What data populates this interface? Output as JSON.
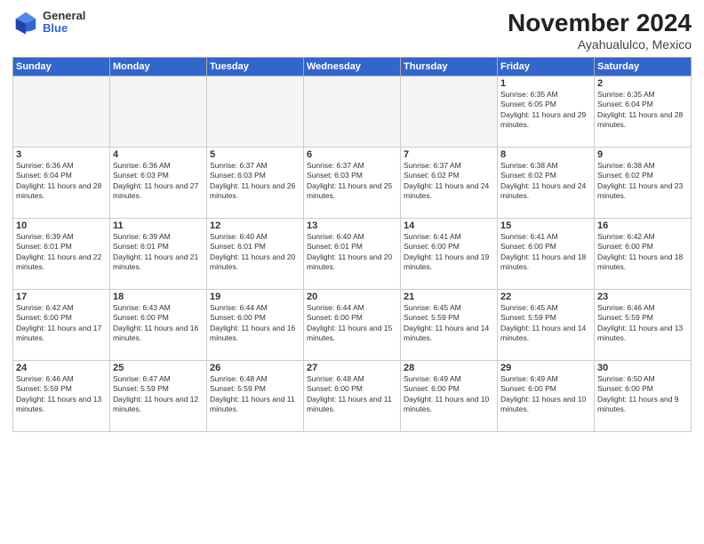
{
  "header": {
    "logo": {
      "general": "General",
      "blue": "Blue"
    },
    "title": "November 2024",
    "subtitle": "Ayahualulco, Mexico"
  },
  "weekdays": [
    "Sunday",
    "Monday",
    "Tuesday",
    "Wednesday",
    "Thursday",
    "Friday",
    "Saturday"
  ],
  "weeks": [
    [
      {
        "day": "",
        "info": "",
        "empty": true
      },
      {
        "day": "",
        "info": "",
        "empty": true
      },
      {
        "day": "",
        "info": "",
        "empty": true
      },
      {
        "day": "",
        "info": "",
        "empty": true
      },
      {
        "day": "",
        "info": "",
        "empty": true
      },
      {
        "day": "1",
        "info": "Sunrise: 6:35 AM\nSunset: 6:05 PM\nDaylight: 11 hours and 29 minutes.",
        "empty": false
      },
      {
        "day": "2",
        "info": "Sunrise: 6:35 AM\nSunset: 6:04 PM\nDaylight: 11 hours and 28 minutes.",
        "empty": false
      }
    ],
    [
      {
        "day": "3",
        "info": "Sunrise: 6:36 AM\nSunset: 6:04 PM\nDaylight: 11 hours and 28 minutes.",
        "empty": false
      },
      {
        "day": "4",
        "info": "Sunrise: 6:36 AM\nSunset: 6:03 PM\nDaylight: 11 hours and 27 minutes.",
        "empty": false
      },
      {
        "day": "5",
        "info": "Sunrise: 6:37 AM\nSunset: 6:03 PM\nDaylight: 11 hours and 26 minutes.",
        "empty": false
      },
      {
        "day": "6",
        "info": "Sunrise: 6:37 AM\nSunset: 6:03 PM\nDaylight: 11 hours and 25 minutes.",
        "empty": false
      },
      {
        "day": "7",
        "info": "Sunrise: 6:37 AM\nSunset: 6:02 PM\nDaylight: 11 hours and 24 minutes.",
        "empty": false
      },
      {
        "day": "8",
        "info": "Sunrise: 6:38 AM\nSunset: 6:02 PM\nDaylight: 11 hours and 24 minutes.",
        "empty": false
      },
      {
        "day": "9",
        "info": "Sunrise: 6:38 AM\nSunset: 6:02 PM\nDaylight: 11 hours and 23 minutes.",
        "empty": false
      }
    ],
    [
      {
        "day": "10",
        "info": "Sunrise: 6:39 AM\nSunset: 6:01 PM\nDaylight: 11 hours and 22 minutes.",
        "empty": false
      },
      {
        "day": "11",
        "info": "Sunrise: 6:39 AM\nSunset: 6:01 PM\nDaylight: 11 hours and 21 minutes.",
        "empty": false
      },
      {
        "day": "12",
        "info": "Sunrise: 6:40 AM\nSunset: 6:01 PM\nDaylight: 11 hours and 20 minutes.",
        "empty": false
      },
      {
        "day": "13",
        "info": "Sunrise: 6:40 AM\nSunset: 6:01 PM\nDaylight: 11 hours and 20 minutes.",
        "empty": false
      },
      {
        "day": "14",
        "info": "Sunrise: 6:41 AM\nSunset: 6:00 PM\nDaylight: 11 hours and 19 minutes.",
        "empty": false
      },
      {
        "day": "15",
        "info": "Sunrise: 6:41 AM\nSunset: 6:00 PM\nDaylight: 11 hours and 18 minutes.",
        "empty": false
      },
      {
        "day": "16",
        "info": "Sunrise: 6:42 AM\nSunset: 6:00 PM\nDaylight: 11 hours and 18 minutes.",
        "empty": false
      }
    ],
    [
      {
        "day": "17",
        "info": "Sunrise: 6:42 AM\nSunset: 6:00 PM\nDaylight: 11 hours and 17 minutes.",
        "empty": false
      },
      {
        "day": "18",
        "info": "Sunrise: 6:43 AM\nSunset: 6:00 PM\nDaylight: 11 hours and 16 minutes.",
        "empty": false
      },
      {
        "day": "19",
        "info": "Sunrise: 6:44 AM\nSunset: 6:00 PM\nDaylight: 11 hours and 16 minutes.",
        "empty": false
      },
      {
        "day": "20",
        "info": "Sunrise: 6:44 AM\nSunset: 6:00 PM\nDaylight: 11 hours and 15 minutes.",
        "empty": false
      },
      {
        "day": "21",
        "info": "Sunrise: 6:45 AM\nSunset: 5:59 PM\nDaylight: 11 hours and 14 minutes.",
        "empty": false
      },
      {
        "day": "22",
        "info": "Sunrise: 6:45 AM\nSunset: 5:59 PM\nDaylight: 11 hours and 14 minutes.",
        "empty": false
      },
      {
        "day": "23",
        "info": "Sunrise: 6:46 AM\nSunset: 5:59 PM\nDaylight: 11 hours and 13 minutes.",
        "empty": false
      }
    ],
    [
      {
        "day": "24",
        "info": "Sunrise: 6:46 AM\nSunset: 5:59 PM\nDaylight: 11 hours and 13 minutes.",
        "empty": false
      },
      {
        "day": "25",
        "info": "Sunrise: 6:47 AM\nSunset: 5:59 PM\nDaylight: 11 hours and 12 minutes.",
        "empty": false
      },
      {
        "day": "26",
        "info": "Sunrise: 6:48 AM\nSunset: 5:59 PM\nDaylight: 11 hours and 11 minutes.",
        "empty": false
      },
      {
        "day": "27",
        "info": "Sunrise: 6:48 AM\nSunset: 6:00 PM\nDaylight: 11 hours and 11 minutes.",
        "empty": false
      },
      {
        "day": "28",
        "info": "Sunrise: 6:49 AM\nSunset: 6:00 PM\nDaylight: 11 hours and 10 minutes.",
        "empty": false
      },
      {
        "day": "29",
        "info": "Sunrise: 6:49 AM\nSunset: 6:00 PM\nDaylight: 11 hours and 10 minutes.",
        "empty": false
      },
      {
        "day": "30",
        "info": "Sunrise: 6:50 AM\nSunset: 6:00 PM\nDaylight: 11 hours and 9 minutes.",
        "empty": false
      }
    ]
  ]
}
